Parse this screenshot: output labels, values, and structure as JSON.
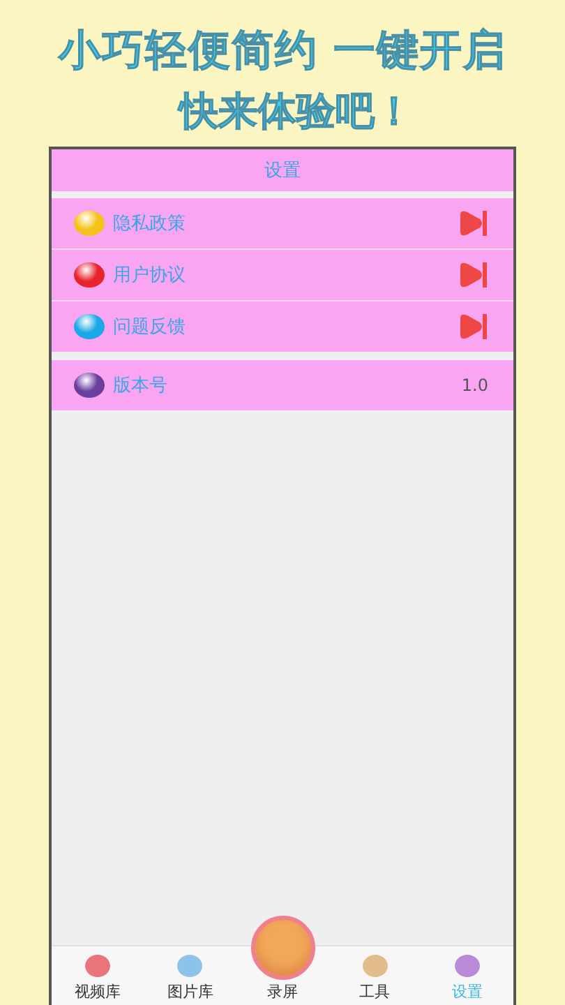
{
  "headline": [
    "小巧轻便简约 一键开启",
    "快来体验吧！"
  ],
  "header": {
    "title": "设置"
  },
  "groups": [
    {
      "rows": [
        {
          "label": "隐私政策",
          "color": "#f5c21b",
          "kind": "link"
        },
        {
          "label": "用户协议",
          "color": "#e8232e",
          "kind": "link"
        },
        {
          "label": "问题反馈",
          "color": "#1aa8e6",
          "kind": "link"
        }
      ]
    },
    {
      "rows": [
        {
          "label": "版本号",
          "color": "#6b3f9e",
          "kind": "value",
          "value": "1.0"
        }
      ]
    }
  ],
  "tabs": [
    {
      "label": "视频库",
      "color": "#e9747c",
      "selected": false,
      "kind": "tab"
    },
    {
      "label": "图片库",
      "color": "#8cc3e8",
      "selected": false,
      "kind": "tab"
    },
    {
      "label": "录屏",
      "color": "#f2a85a",
      "selected": false,
      "kind": "record"
    },
    {
      "label": "工具",
      "color": "#e2bc8c",
      "selected": false,
      "kind": "tab"
    },
    {
      "label": "设置",
      "color": "#b98ad8",
      "selected": true,
      "kind": "tab"
    }
  ]
}
